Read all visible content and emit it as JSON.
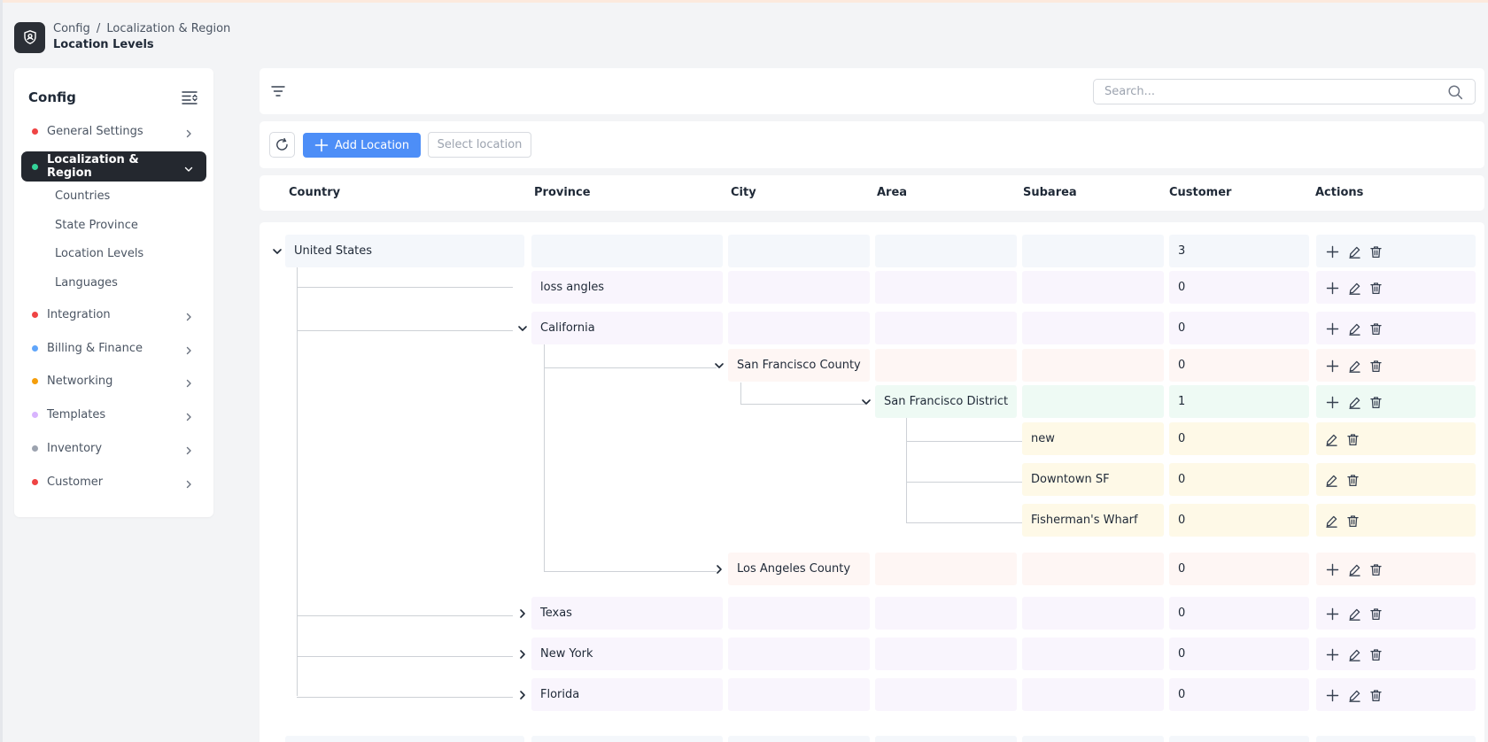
{
  "header": {
    "breadcrumb_parent": "Config",
    "breadcrumb_separator": "/",
    "breadcrumb_section": "Localization & Region",
    "page_title": "Location Levels"
  },
  "sidebar": {
    "title": "Config",
    "items": [
      {
        "label": "General Settings",
        "dot_color": "#ef4444",
        "expanded": false
      },
      {
        "label": "Localization & Region",
        "dot_color": "#34d399",
        "expanded": true,
        "active": true
      },
      {
        "label": "Integration",
        "dot_color": "#ef4444",
        "expanded": false
      },
      {
        "label": "Billing & Finance",
        "dot_color": "#60a5fa",
        "expanded": false
      },
      {
        "label": "Networking",
        "dot_color": "#f59e0b",
        "expanded": false
      },
      {
        "label": "Templates",
        "dot_color": "#d8b4fe",
        "expanded": false
      },
      {
        "label": "Inventory",
        "dot_color": "#9ca3af",
        "expanded": false
      },
      {
        "label": "Customer",
        "dot_color": "#ef4444",
        "expanded": false
      }
    ],
    "subitems": [
      "Countries",
      "State Province",
      "Location Levels",
      "Languages"
    ]
  },
  "search": {
    "placeholder": "Search..."
  },
  "toolbar": {
    "add_label": "Add Location",
    "select_placeholder": "Select location"
  },
  "table": {
    "columns": [
      "Country",
      "Province",
      "City",
      "Area",
      "Subarea",
      "Customer",
      "Actions"
    ],
    "rows": [
      {
        "level": 0,
        "name": "United States",
        "toggle": "expanded",
        "customer": "3",
        "color": "#f4f7fb",
        "add": true
      },
      {
        "level": 1,
        "name": "loss angles",
        "toggle": "none",
        "customer": "0",
        "color": "#f9f5fd",
        "add": true
      },
      {
        "level": 1,
        "name": "California",
        "toggle": "expanded",
        "customer": "0",
        "color": "#f9f5fd",
        "add": true
      },
      {
        "level": 2,
        "name": "San Francisco County",
        "toggle": "expanded",
        "customer": "0",
        "color": "#fef6f4",
        "add": true
      },
      {
        "level": 3,
        "name": "San Francisco District",
        "toggle": "expanded",
        "customer": "1",
        "color": "#eefaf4",
        "add": true
      },
      {
        "level": 4,
        "name": "new",
        "toggle": "none",
        "customer": "0",
        "color": "#fef9e7",
        "add": false
      },
      {
        "level": 4,
        "name": "Downtown SF",
        "toggle": "none",
        "customer": "0",
        "color": "#fef9e7",
        "add": false
      },
      {
        "level": 4,
        "name": "Fisherman's Wharf",
        "toggle": "none",
        "customer": "0",
        "color": "#fef9e7",
        "add": false
      },
      {
        "level": 2,
        "name": "Los Angeles County",
        "toggle": "collapsed",
        "customer": "0",
        "color": "#fef6f4",
        "add": true
      },
      {
        "level": 1,
        "name": "Texas",
        "toggle": "collapsed",
        "customer": "0",
        "color": "#f9f5fd",
        "add": true
      },
      {
        "level": 1,
        "name": "New York",
        "toggle": "collapsed",
        "customer": "0",
        "color": "#f9f5fd",
        "add": true
      },
      {
        "level": 1,
        "name": "Florida",
        "toggle": "collapsed",
        "customer": "0",
        "color": "#f9f5fd",
        "add": true
      }
    ]
  },
  "colors": {
    "accent": "#4d8ef7",
    "sidebar_active_bg": "#24282f",
    "tree_line": "#cdd1d6"
  },
  "icons": {
    "logo": "user-shield-icon",
    "sidebar_toggle": "collapse-menu-icon",
    "filter": "filter-icon",
    "search": "search-icon",
    "refresh": "refresh-icon",
    "add": "plus-icon",
    "edit": "pencil-icon",
    "delete": "trash-icon"
  }
}
